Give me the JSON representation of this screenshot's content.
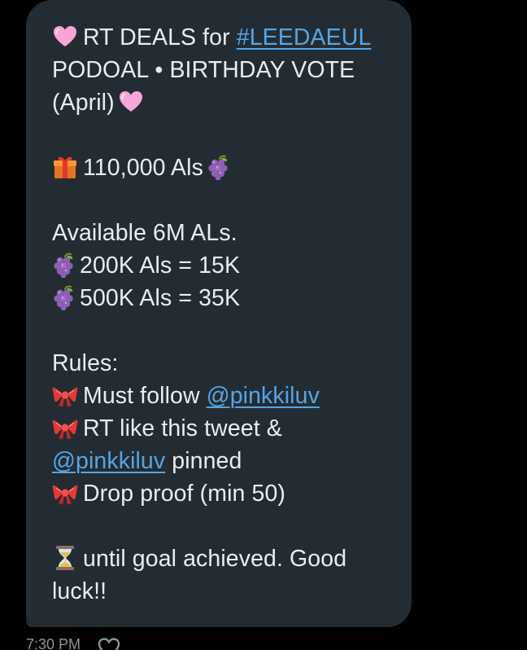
{
  "message": {
    "title_prefix": "RT DEALS for",
    "hashtag": "#LEEDAEUL",
    "title_line2": "PODOAL • BIRTHDAY VOTE",
    "title_line3": "(April)",
    "prize": "110,000 Als",
    "available": "Available 6M ALs.",
    "deals": [
      "200K Als = 15K",
      "500K Als = 35K"
    ],
    "rules_heading": "Rules:",
    "rule1_prefix": "Must follow",
    "mention": "@pinkkiluv",
    "rule2_line1": "RT like this tweet &",
    "rule2_suffix": "pinned",
    "rule3": "Drop proof (min 50)",
    "closing_line1": "until goal achieved. Good",
    "closing_line2": "luck!!"
  },
  "footer": {
    "time": "7:30 PM"
  },
  "colors": {
    "bubble": "#242c33",
    "text": "#e9edef",
    "link": "#53a6e5",
    "meta": "#8a959c"
  },
  "icons": [
    "pink-heart-icon",
    "gift-icon",
    "grapes-icon",
    "ribbon-icon",
    "hourglass-icon",
    "heart-reaction-icon"
  ]
}
